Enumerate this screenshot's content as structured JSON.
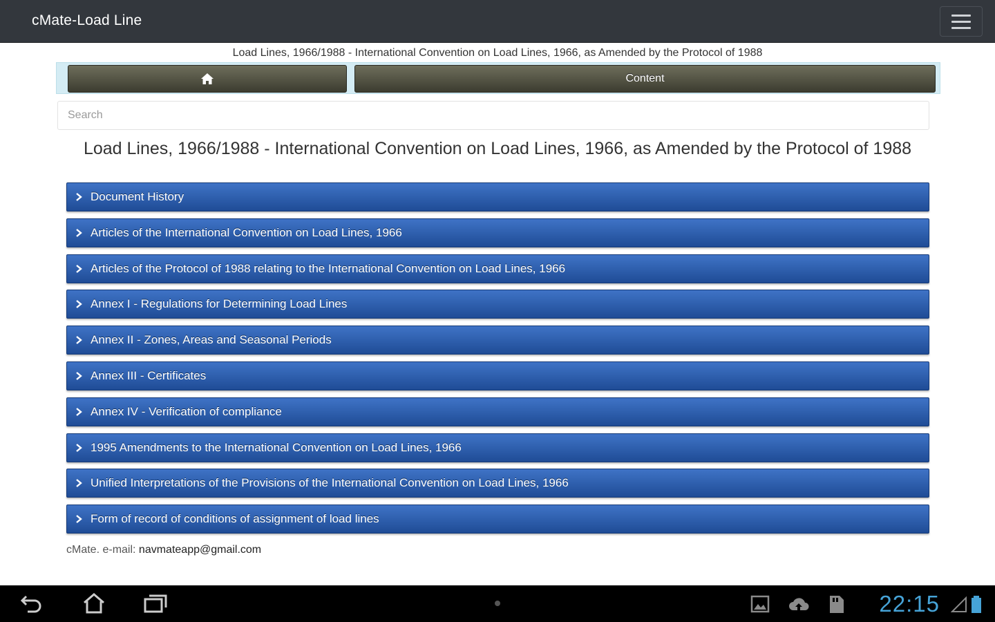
{
  "app": {
    "title": "cMate-Load Line"
  },
  "subtitle": "Load Lines, 1966/1988 - International Convention on Load Lines, 1966, as Amended by the Protocol of 1988",
  "toolbar": {
    "content_label": "Content"
  },
  "search": {
    "placeholder": "Search"
  },
  "page_title": "Load Lines, 1966/1988 - International Convention on Load Lines, 1966, as Amended by the Protocol of 1988",
  "sections": [
    {
      "label": "Document History"
    },
    {
      "label": "Articles of the International Convention on Load Lines, 1966"
    },
    {
      "label": "Articles of the Protocol of 1988 relating to the International Convention on Load Lines, 1966"
    },
    {
      "label": "Annex I - Regulations for Determining Load Lines"
    },
    {
      "label": "Annex II - Zones, Areas and Seasonal Periods"
    },
    {
      "label": "Annex III - Certificates"
    },
    {
      "label": "Annex IV - Verification of compliance"
    },
    {
      "label": "1995 Amendments to the International Convention on Load Lines, 1966"
    },
    {
      "label": "Unified Interpretations of the Provisions of the International Convention on Load Lines, 1966"
    },
    {
      "label": "Form of record of conditions of assignment of load lines"
    }
  ],
  "footer": {
    "prefix": "cMate. e-mail: ",
    "email": "navmateapp@gmail.com"
  },
  "system": {
    "clock": "22:15"
  },
  "colors": {
    "appbar": "#33373d",
    "section_blue": "#2f5fb0",
    "toolbar_bg": "#d4ecf4",
    "clock": "#46a3d7"
  }
}
